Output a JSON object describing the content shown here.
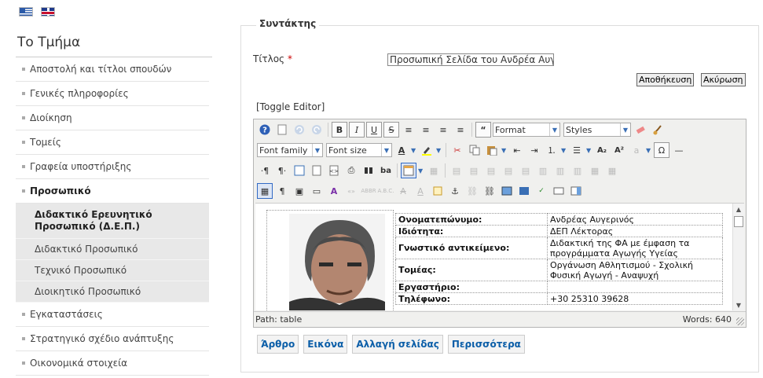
{
  "languages": [
    {
      "icon": "greek-flag-icon"
    },
    {
      "icon": "uk-flag-icon"
    }
  ],
  "sidebar": {
    "title": "Το Τμήμα",
    "items": [
      {
        "label": "Αποστολή και τίτλοι σπουδών"
      },
      {
        "label": "Γενικές πληροφορίες"
      },
      {
        "label": "Διοίκηση"
      },
      {
        "label": "Τομείς"
      },
      {
        "label": "Γραφεία υποστήριξης"
      },
      {
        "label": "Προσωπικό"
      }
    ],
    "subitems": [
      {
        "label": "Διδακτικό Ερευνητικό Προσωπικό (Δ.Ε.Π.)"
      },
      {
        "label": "Διδακτικό Προσωπικό"
      },
      {
        "label": "Τεχνικό Προσωπικό"
      },
      {
        "label": "Διοικητικό Προσωπικό"
      }
    ],
    "items_after": [
      {
        "label": "Εγκαταστάσεις"
      },
      {
        "label": "Στρατηγικό σχέδιο ανάπτυξης"
      },
      {
        "label": "Οικονομικά στοιχεία"
      }
    ]
  },
  "form": {
    "legend": "Συντάκτης",
    "title_label": "Τίτλος",
    "required_mark": "*",
    "title_value": "Προσωπική Σελίδα του Ανδρέα Αυγε",
    "save_label": "Αποθήκευση",
    "cancel_label": "Ακύρωση",
    "toggle_editor": "[Toggle Editor]"
  },
  "editor": {
    "format_select": "Format",
    "styles_select": "Styles",
    "font_family_select": "Font family",
    "font_size_select": "Font size",
    "path": "Path:  table",
    "words": "Words: 640",
    "table_rows": [
      {
        "key": "Ονοματεπώνυμο:",
        "value": "Ανδρέας Αυγερινός"
      },
      {
        "key": "Ιδιότητα:",
        "value": "ΔΕΠ Λέκτορας"
      },
      {
        "key": "Γνωστικό αντικείμενο:",
        "value": "Διδακτική της ΦΑ με έμφαση τα προγράμματα Αγωγής Υγείας"
      },
      {
        "key": "Τομέας:",
        "value": "Οργάνωση Αθλητισμού - Σχολική Φυσική Αγωγή - Αναψυχή"
      },
      {
        "key": "Εργαστήριο:",
        "value": ""
      },
      {
        "key": "Τηλέφωνο:",
        "value": "+30 25310 39628"
      }
    ]
  },
  "actions": {
    "article": "Άρθρο",
    "image": "Εικόνα",
    "pagebreak": "Αλλαγή σελίδας",
    "more": "Περισσότερα"
  }
}
